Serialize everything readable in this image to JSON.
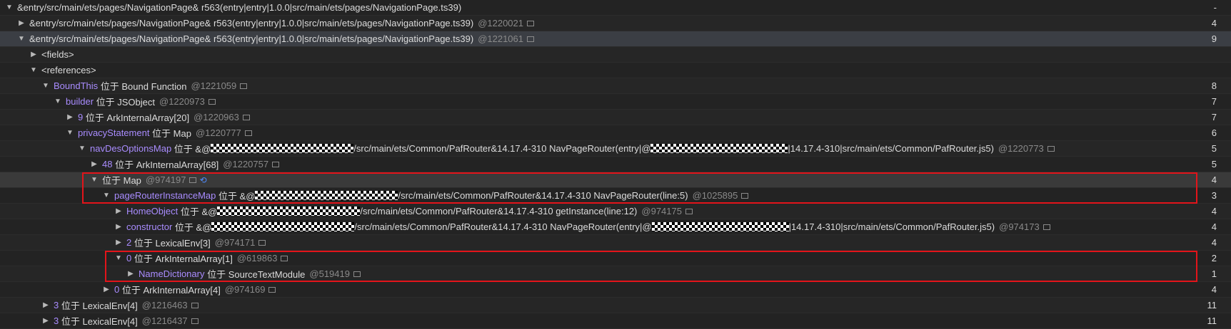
{
  "rows": [
    {
      "indent": 0,
      "arrow": "▼",
      "prefix": "",
      "name": "&entry/src/main/ets/pages/NavigationPage& r563(entry|entry|1.0.0|src/main/ets/pages/NavigationPage.ts39)",
      "purple": false,
      "suffix": "",
      "id": "",
      "box": false,
      "count": "-"
    },
    {
      "indent": 1,
      "arrow": "▶",
      "prefix": "",
      "name": "&entry/src/main/ets/pages/NavigationPage& r563(entry|entry|1.0.0|src/main/ets/pages/NavigationPage.ts39)",
      "purple": false,
      "suffix": "",
      "id": "@1220021",
      "box": true,
      "count": "4"
    },
    {
      "indent": 1,
      "arrow": "▼",
      "prefix": "",
      "name": "&entry/src/main/ets/pages/NavigationPage& r563(entry|entry|1.0.0|src/main/ets/pages/NavigationPage.ts39)",
      "purple": false,
      "suffix": "",
      "id": "@1221061",
      "box": true,
      "count": "9"
    },
    {
      "indent": 2,
      "arrow": "▶",
      "prefix": "",
      "name": "<fields>",
      "purple": false,
      "suffix": "",
      "id": "",
      "box": false,
      "count": ""
    },
    {
      "indent": 2,
      "arrow": "▼",
      "prefix": "",
      "name": "<references>",
      "purple": false,
      "suffix": "",
      "id": "",
      "box": false,
      "count": ""
    },
    {
      "indent": 3,
      "arrow": "▼",
      "prefix": "",
      "name": "BoundThis",
      "purple": true,
      "suffix": " 位于 Bound Function",
      "id": "@1221059",
      "box": true,
      "count": "8"
    },
    {
      "indent": 4,
      "arrow": "▼",
      "prefix": "",
      "name": "builder",
      "purple": true,
      "suffix": " 位于 JSObject",
      "id": "@1220973",
      "box": true,
      "count": "7"
    },
    {
      "indent": 5,
      "arrow": "▶",
      "prefix": "",
      "name": "9",
      "purple": true,
      "suffix": " 位于 ArkInternalArray[20]",
      "id": "@1220963",
      "box": true,
      "count": "7"
    },
    {
      "indent": 5,
      "arrow": "▼",
      "prefix": "",
      "name": "privacyStatement",
      "purple": true,
      "suffix": " 位于 Map",
      "id": "@1220777",
      "box": true,
      "count": "6"
    },
    {
      "indent": 6,
      "arrow": "▼",
      "prefix": "",
      "name": "navDesOptionsMap",
      "purple": true,
      "suffix": " 位于 &@",
      "mask1": 200,
      "suffix2": "/src/main/ets/Common/PafRouter&14.17.4-310 NavPageRouter(entry|@",
      "mask2": 192,
      "suffix3": "|14.17.4-310|src/main/ets/Common/PafRouter.js5)",
      "id": "@1220773",
      "box": true,
      "count": "5"
    },
    {
      "indent": 7,
      "arrow": "▶",
      "prefix": "",
      "name": "48",
      "purple": true,
      "suffix": " 位于 ArkInternalArray[68]",
      "id": "@1220757",
      "box": true,
      "count": "5"
    },
    {
      "indent": 7,
      "arrow": "▼",
      "prefix": "",
      "name": "",
      "purple": false,
      "suffix": "位于 Map",
      "id": "@974197",
      "box": true,
      "refresh": true,
      "count": "4"
    },
    {
      "indent": 8,
      "arrow": "▼",
      "prefix": "",
      "name": "pageRouterInstanceMap",
      "purple": true,
      "suffix": " 位于 &@",
      "mask1": 200,
      "suffix2": "/src/main/ets/Common/PafRouter&14.17.4-310 NavPageRouter(line:5)",
      "id": "@1025895",
      "box": true,
      "count": "3"
    },
    {
      "indent": 9,
      "arrow": "▶",
      "prefix": "",
      "name": "HomeObject",
      "purple": true,
      "suffix": " 位于 &@",
      "mask1": 200,
      "suffix2": "/src/main/ets/Common/PafRouter&14.17.4-310 getInstance(line:12)",
      "id": "@974175",
      "box": true,
      "count": "4"
    },
    {
      "indent": 9,
      "arrow": "▶",
      "prefix": "",
      "name": "constructor",
      "purple": true,
      "suffix": " 位于 &@",
      "mask1": 200,
      "suffix2": "/src/main/ets/Common/PafRouter&14.17.4-310 NavPageRouter(entry|@",
      "mask2": 192,
      "suffix3": "|14.17.4-310|src/main/ets/Common/PafRouter.js5)",
      "id": "@974173",
      "box": true,
      "count": "4"
    },
    {
      "indent": 9,
      "arrow": "▶",
      "prefix": "",
      "name": "2",
      "purple": true,
      "suffix": " 位于 LexicalEnv[3]",
      "id": "@974171",
      "box": true,
      "count": "4"
    },
    {
      "indent": 9,
      "arrow": "▼",
      "prefix": "",
      "name": "0",
      "purple": true,
      "suffix": " 位于 ArkInternalArray[1]",
      "id": "@619863",
      "box": true,
      "count": "2"
    },
    {
      "indent": 10,
      "arrow": "▶",
      "prefix": "",
      "name": "NameDictionary",
      "purple": true,
      "suffix": " 位于 SourceTextModule",
      "id": "@519419",
      "box": true,
      "count": "1"
    },
    {
      "indent": 8,
      "arrow": "▶",
      "prefix": "",
      "name": "0",
      "purple": true,
      "suffix": " 位于 ArkInternalArray[4]",
      "id": "@974169",
      "box": true,
      "count": "4"
    },
    {
      "indent": 3,
      "arrow": "▶",
      "prefix": "",
      "name": "3",
      "purple": true,
      "suffix": " 位于 LexicalEnv[4]",
      "id": "@1216463",
      "box": true,
      "count": "11"
    },
    {
      "indent": 3,
      "arrow": "▶",
      "prefix": "",
      "name": "3",
      "purple": true,
      "suffix": " 位于 LexicalEnv[4]",
      "id": "@1216437",
      "box": true,
      "count": "11"
    }
  ]
}
